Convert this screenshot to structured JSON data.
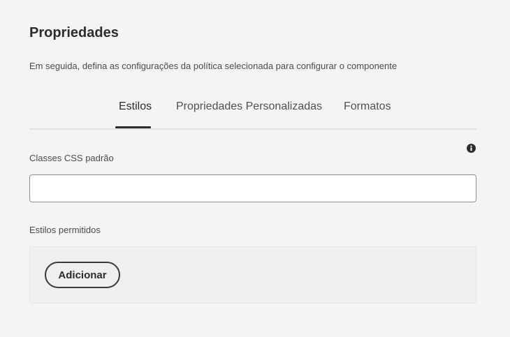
{
  "header": {
    "title": "Propriedades",
    "description": "Em seguida, defina as configurações da política selecionada para configurar o componente"
  },
  "tabs": [
    {
      "label": "Estilos",
      "selected": true
    },
    {
      "label": "Propriedades Personalizadas",
      "selected": false
    },
    {
      "label": "Formatos",
      "selected": false
    }
  ],
  "default_css": {
    "label": "Classes CSS padrão",
    "value": "",
    "placeholder": "",
    "info_icon": "info-icon"
  },
  "allowed_styles": {
    "label": "Estilos permitidos",
    "add_button_label": "Adicionar"
  },
  "colors": {
    "background": "#f4f4f4",
    "text": "#2c2c2c",
    "active_tab_indicator": "#2c2c2c"
  }
}
